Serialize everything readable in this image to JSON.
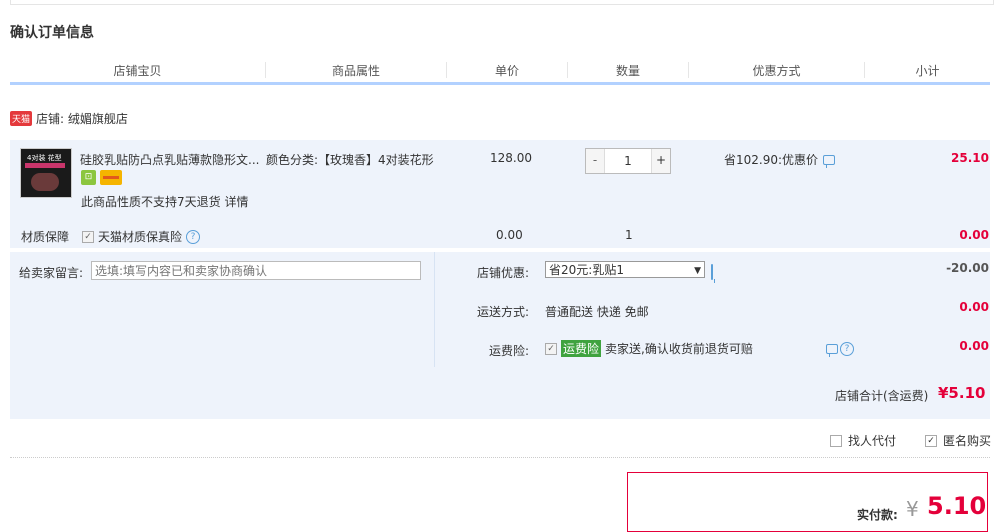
{
  "section_title": "确认订单信息",
  "headers": [
    "店铺宝贝",
    "商品属性",
    "单价",
    "数量",
    "优惠方式",
    "小计"
  ],
  "store": {
    "badge": "天猫",
    "label": "店铺: 绒媚旗舰店"
  },
  "item": {
    "title": "硅胶乳贴防凸点乳贴薄款隐形文...",
    "thumbnail_text": "4对装 花型",
    "attribute": "颜色分类:【玫瑰香】4对装花形",
    "no_return": "此商品性质不支持7天退货",
    "details_link": "详情",
    "price": "128.00",
    "quantity": "1",
    "qty_minus": "-",
    "qty_plus": "+",
    "promotion": "省102.90:优惠价",
    "subtotal": "25.10"
  },
  "material": {
    "label": "材质保障",
    "insurance": "天猫材质保真险",
    "price": "0.00",
    "quantity": "1",
    "subtotal": "0.00"
  },
  "message": {
    "label": "给卖家留言:",
    "placeholder": "选填:填写内容已和卖家协商确认"
  },
  "store_discount": {
    "label": "店铺优惠:",
    "selected": "省20元:乳贴1",
    "value": "-20.00"
  },
  "shipping": {
    "label": "运送方式:",
    "value": "普通配送 快递 免邮",
    "cost": "0.00"
  },
  "freight_insurance": {
    "label": "运费险:",
    "badge": "运费险",
    "desc": "卖家送,确认收货前退货可赔",
    "cost": "0.00"
  },
  "store_total": {
    "label": "店铺合计(含运费)",
    "value": "¥5.10"
  },
  "options": {
    "proxy_pay": "找人代付",
    "anonymous": "匿名购买",
    "anonymous_checked": true
  },
  "payment": {
    "label": "实付款:",
    "currency": "¥",
    "amount": "5.10"
  },
  "colors": {
    "accent_red": "#e4003a",
    "header_border": "#b2d1ff",
    "row_bg": "#eef3fb"
  }
}
